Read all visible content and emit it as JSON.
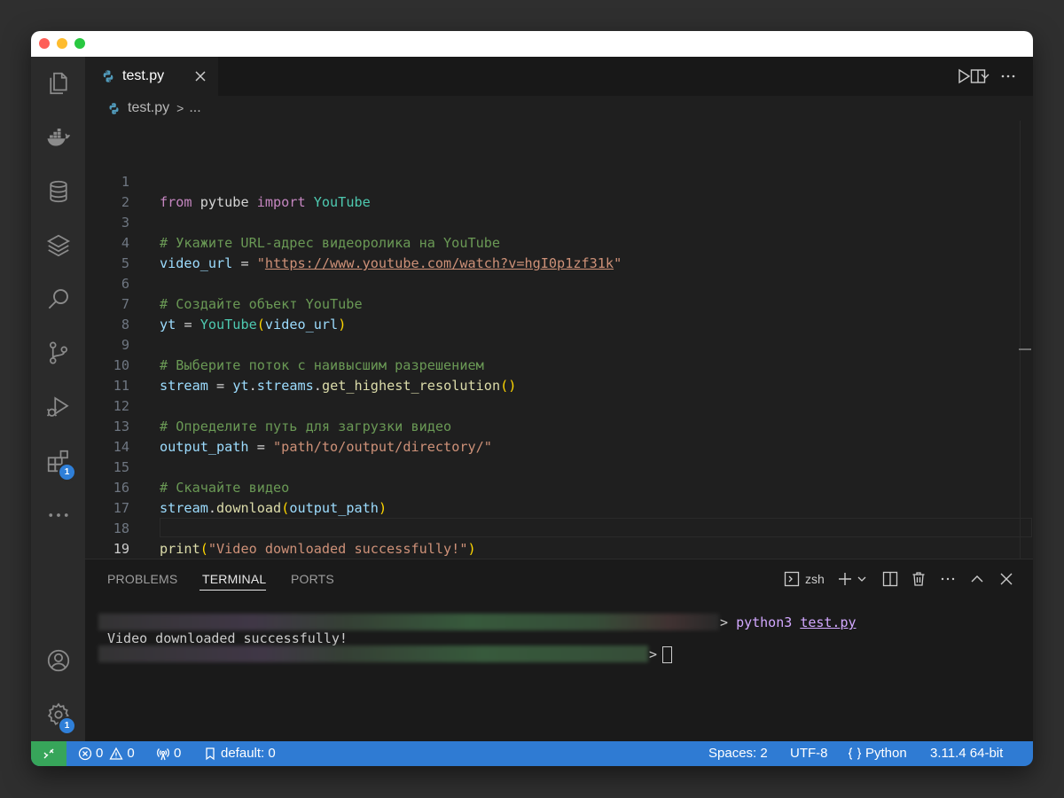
{
  "tab": {
    "filename": "test.py"
  },
  "breadcrumb": {
    "file": "test.py",
    "separator": ">",
    "trail": "..."
  },
  "editor": {
    "line_numbers": [
      "1",
      "2",
      "3",
      "4",
      "5",
      "6",
      "7",
      "8",
      "9",
      "10",
      "11",
      "12",
      "13",
      "14",
      "15",
      "16",
      "17",
      "18",
      "19"
    ],
    "lines": {
      "l1": {
        "kw1": "from",
        "mod": " pytube ",
        "kw2": "import",
        "cls": " YouTube"
      },
      "l3": {
        "comment": "# Укажите URL-адрес видеоролика на YouTube"
      },
      "l4": {
        "var": "video_url",
        "op": " = ",
        "q1": "\"",
        "url": "https://www.youtube.com/watch?v=hgI0p1zf31k",
        "q2": "\""
      },
      "l6": {
        "comment": "# Создайте объект YouTube"
      },
      "l7": {
        "var": "yt",
        "op": " = ",
        "cls": "YouTube",
        "p1": "(",
        "arg": "video_url",
        "p2": ")"
      },
      "l9": {
        "comment": "# Выберите поток с наивысшим разрешением"
      },
      "l10": {
        "var": "stream",
        "op": " = ",
        "obj": "yt",
        "dot1": ".",
        "attr": "streams",
        "dot2": ".",
        "fn": "get_highest_resolution",
        "parens": "()"
      },
      "l12": {
        "comment": "# Определите путь для загрузки видео"
      },
      "l13": {
        "var": "output_path",
        "op": " = ",
        "str": "\"path/to/output/directory/\""
      },
      "l15": {
        "comment": "# Скачайте видео"
      },
      "l16": {
        "obj": "stream",
        "dot": ".",
        "fn": "download",
        "p1": "(",
        "arg": "output_path",
        "p2": ")"
      },
      "l18": {
        "fn": "print",
        "p1": "(",
        "str": "\"Video downloaded successfully!\"",
        "p2": ")"
      }
    }
  },
  "panel": {
    "tabs": [
      "PROBLEMS",
      "TERMINAL",
      "PORTS"
    ],
    "active_tab": "TERMINAL",
    "shell": "zsh"
  },
  "terminal": {
    "prompt": ">",
    "command": "python3",
    "argument": "test.py",
    "output": "Video downloaded successfully!"
  },
  "status": {
    "errors": "0",
    "warnings": "0",
    "ports": "0",
    "branch_label": "default: 0",
    "spaces": "Spaces: 2",
    "encoding": "UTF-8",
    "language": "Python",
    "interpreter": "3.11.4 64-bit"
  },
  "badges": {
    "extensions": "1",
    "settings": "1"
  },
  "colors": {
    "statusbar": "#2f7bd3",
    "remote": "#37a55a",
    "badge": "#2f7fd8"
  },
  "icons": [
    "files-icon",
    "docker-icon",
    "database-icon",
    "layers-icon",
    "search-icon",
    "source-control-icon",
    "run-debug-icon",
    "extensions-icon",
    "more-icon",
    "account-icon",
    "settings-gear-icon"
  ]
}
